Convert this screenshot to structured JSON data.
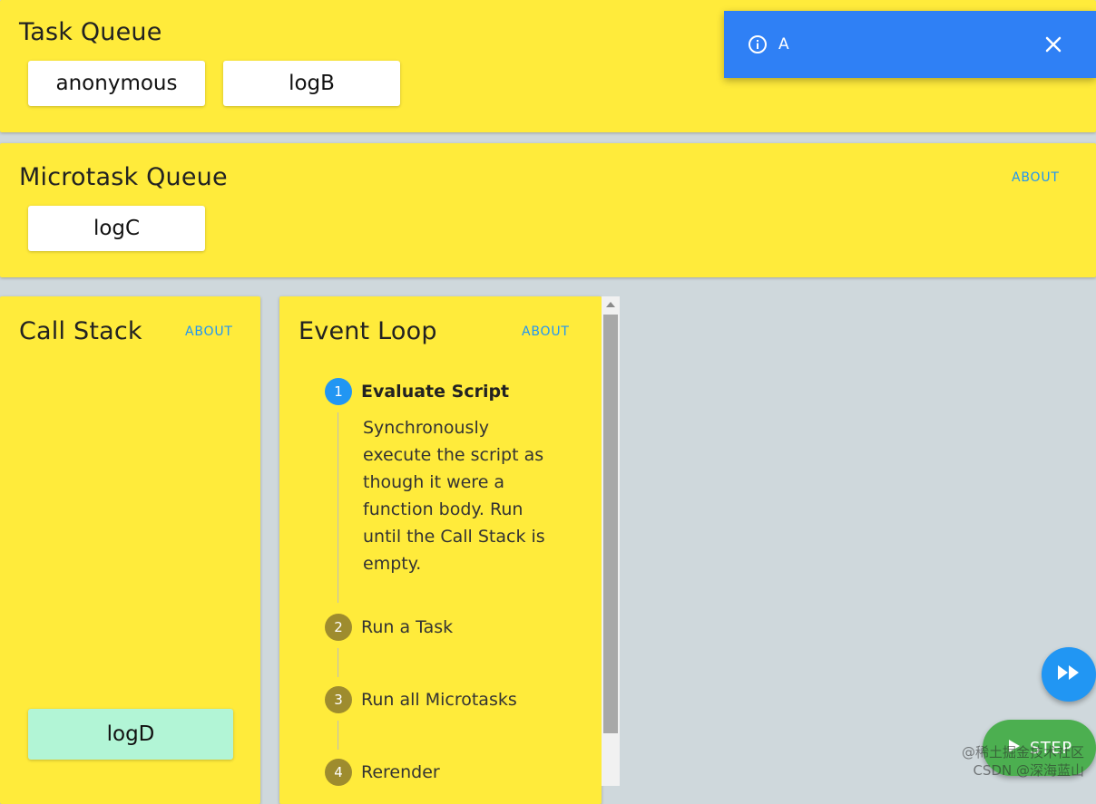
{
  "task_queue": {
    "title": "Task Queue",
    "items": [
      "anonymous",
      "logB"
    ]
  },
  "microtask_queue": {
    "title": "Microtask Queue",
    "about_label": "ABOUT",
    "items": [
      "logC"
    ]
  },
  "call_stack": {
    "title": "Call Stack",
    "about_label": "ABOUT",
    "items": [
      "logD"
    ]
  },
  "event_loop": {
    "title": "Event Loop",
    "about_label": "ABOUT",
    "active_step": 1,
    "steps": [
      {
        "number": "1",
        "label": "Evaluate Script",
        "description": "Synchronously execute the script as though it were a function body. Run until the Call Stack is empty."
      },
      {
        "number": "2",
        "label": "Run a Task"
      },
      {
        "number": "3",
        "label": "Run all Microtasks"
      },
      {
        "number": "4",
        "label": "Rerender"
      }
    ]
  },
  "notification": {
    "text": "A",
    "icon": "info-icon",
    "close_icon": "close-icon"
  },
  "controls": {
    "fast_forward_icon": "fast-forward-icon",
    "step_label": "STEP",
    "step_icon": "play-icon"
  },
  "watermark": {
    "line1": "@稀土掘金技术社区",
    "line2": "CSDN @深海蓝山"
  },
  "colors": {
    "card": "#ffeb3b",
    "background": "#cfd8dc",
    "accent": "#2196f3",
    "step_button": "#4caf50",
    "call_stack_chip": "#b2f5d6",
    "notification": "#2f80f5"
  }
}
